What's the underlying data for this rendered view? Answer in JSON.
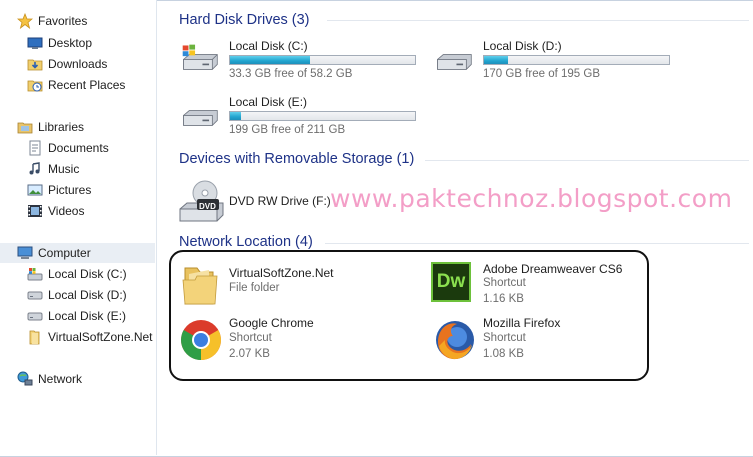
{
  "nav": {
    "favorites": {
      "label": "Favorites",
      "items": [
        {
          "label": "Desktop",
          "icon": "desktop-icon"
        },
        {
          "label": "Downloads",
          "icon": "downloads-icon"
        },
        {
          "label": "Recent Places",
          "icon": "recent-places-icon"
        }
      ]
    },
    "libraries": {
      "label": "Libraries",
      "items": [
        {
          "label": "Documents",
          "icon": "documents-icon"
        },
        {
          "label": "Music",
          "icon": "music-icon"
        },
        {
          "label": "Pictures",
          "icon": "pictures-icon"
        },
        {
          "label": "Videos",
          "icon": "videos-icon"
        }
      ]
    },
    "computer": {
      "label": "Computer",
      "selected": true,
      "items": [
        {
          "label": "Local Disk (C:)",
          "icon": "system-drive-icon"
        },
        {
          "label": "Local Disk (D:)",
          "icon": "drive-icon"
        },
        {
          "label": "Local Disk (E:)",
          "icon": "drive-icon"
        },
        {
          "label": "VirtualSoftZone.Net",
          "icon": "folder-icon"
        }
      ]
    },
    "network": {
      "label": "Network",
      "icon": "network-icon"
    }
  },
  "groups": {
    "hdd": {
      "title": "Hard Disk Drives (3)"
    },
    "removable": {
      "title": "Devices with Removable Storage (1)"
    },
    "network": {
      "title": "Network Location (4)"
    }
  },
  "drives": [
    {
      "name": "Local Disk (C:)",
      "free": "33.3 GB free of 58.2 GB",
      "used_fraction": 0.43,
      "system": true
    },
    {
      "name": "Local Disk (D:)",
      "free": "170 GB free of 195 GB",
      "used_fraction": 0.13,
      "system": false
    },
    {
      "name": "Local Disk (E:)",
      "free": "199 GB free of 211 GB",
      "used_fraction": 0.06,
      "system": false
    }
  ],
  "removable": [
    {
      "name": "DVD RW Drive (F:)",
      "icon_label": "DVD"
    }
  ],
  "network_items": [
    {
      "name": "VirtualSoftZone.Net",
      "type": "File folder",
      "size": "",
      "icon": "folder-icon"
    },
    {
      "name": "Adobe Dreamweaver CS6",
      "type": "Shortcut",
      "size": "1.16 KB",
      "icon": "dreamweaver-icon",
      "icon_label": "Dw"
    },
    {
      "name": "Google Chrome",
      "type": "Shortcut",
      "size": "2.07 KB",
      "icon": "chrome-icon"
    },
    {
      "name": "Mozilla Firefox",
      "type": "Shortcut",
      "size": "1.08 KB",
      "icon": "firefox-icon"
    }
  ],
  "watermark": "www.paktechnoz.blogspot.com",
  "colors": {
    "accent": "#1e3287",
    "bar_fill": "#22a5cf",
    "watermark": "#f39ec7"
  }
}
